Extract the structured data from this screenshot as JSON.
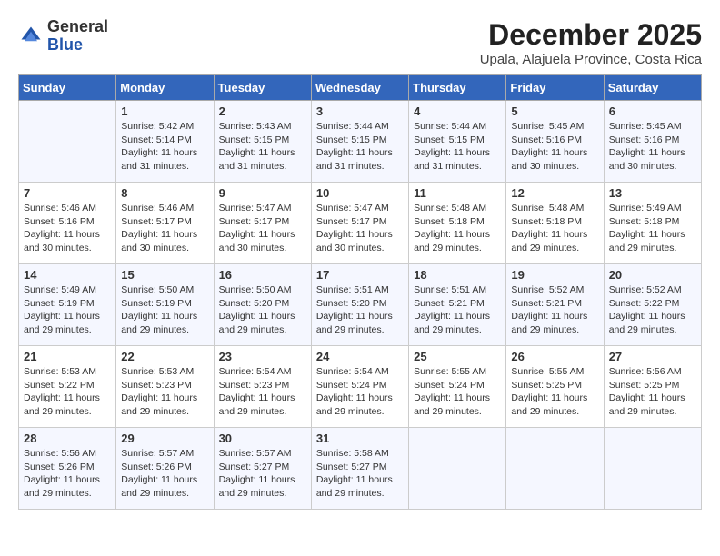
{
  "header": {
    "logo_general": "General",
    "logo_blue": "Blue",
    "month_year": "December 2025",
    "location": "Upala, Alajuela Province, Costa Rica"
  },
  "days_of_week": [
    "Sunday",
    "Monday",
    "Tuesday",
    "Wednesday",
    "Thursday",
    "Friday",
    "Saturday"
  ],
  "weeks": [
    [
      {
        "day": "",
        "info": ""
      },
      {
        "day": "1",
        "info": "Sunrise: 5:42 AM\nSunset: 5:14 PM\nDaylight: 11 hours and 31 minutes."
      },
      {
        "day": "2",
        "info": "Sunrise: 5:43 AM\nSunset: 5:15 PM\nDaylight: 11 hours and 31 minutes."
      },
      {
        "day": "3",
        "info": "Sunrise: 5:44 AM\nSunset: 5:15 PM\nDaylight: 11 hours and 31 minutes."
      },
      {
        "day": "4",
        "info": "Sunrise: 5:44 AM\nSunset: 5:15 PM\nDaylight: 11 hours and 31 minutes."
      },
      {
        "day": "5",
        "info": "Sunrise: 5:45 AM\nSunset: 5:16 PM\nDaylight: 11 hours and 30 minutes."
      },
      {
        "day": "6",
        "info": "Sunrise: 5:45 AM\nSunset: 5:16 PM\nDaylight: 11 hours and 30 minutes."
      }
    ],
    [
      {
        "day": "7",
        "info": "Sunrise: 5:46 AM\nSunset: 5:16 PM\nDaylight: 11 hours and 30 minutes."
      },
      {
        "day": "8",
        "info": "Sunrise: 5:46 AM\nSunset: 5:17 PM\nDaylight: 11 hours and 30 minutes."
      },
      {
        "day": "9",
        "info": "Sunrise: 5:47 AM\nSunset: 5:17 PM\nDaylight: 11 hours and 30 minutes."
      },
      {
        "day": "10",
        "info": "Sunrise: 5:47 AM\nSunset: 5:17 PM\nDaylight: 11 hours and 30 minutes."
      },
      {
        "day": "11",
        "info": "Sunrise: 5:48 AM\nSunset: 5:18 PM\nDaylight: 11 hours and 29 minutes."
      },
      {
        "day": "12",
        "info": "Sunrise: 5:48 AM\nSunset: 5:18 PM\nDaylight: 11 hours and 29 minutes."
      },
      {
        "day": "13",
        "info": "Sunrise: 5:49 AM\nSunset: 5:18 PM\nDaylight: 11 hours and 29 minutes."
      }
    ],
    [
      {
        "day": "14",
        "info": "Sunrise: 5:49 AM\nSunset: 5:19 PM\nDaylight: 11 hours and 29 minutes."
      },
      {
        "day": "15",
        "info": "Sunrise: 5:50 AM\nSunset: 5:19 PM\nDaylight: 11 hours and 29 minutes."
      },
      {
        "day": "16",
        "info": "Sunrise: 5:50 AM\nSunset: 5:20 PM\nDaylight: 11 hours and 29 minutes."
      },
      {
        "day": "17",
        "info": "Sunrise: 5:51 AM\nSunset: 5:20 PM\nDaylight: 11 hours and 29 minutes."
      },
      {
        "day": "18",
        "info": "Sunrise: 5:51 AM\nSunset: 5:21 PM\nDaylight: 11 hours and 29 minutes."
      },
      {
        "day": "19",
        "info": "Sunrise: 5:52 AM\nSunset: 5:21 PM\nDaylight: 11 hours and 29 minutes."
      },
      {
        "day": "20",
        "info": "Sunrise: 5:52 AM\nSunset: 5:22 PM\nDaylight: 11 hours and 29 minutes."
      }
    ],
    [
      {
        "day": "21",
        "info": "Sunrise: 5:53 AM\nSunset: 5:22 PM\nDaylight: 11 hours and 29 minutes."
      },
      {
        "day": "22",
        "info": "Sunrise: 5:53 AM\nSunset: 5:23 PM\nDaylight: 11 hours and 29 minutes."
      },
      {
        "day": "23",
        "info": "Sunrise: 5:54 AM\nSunset: 5:23 PM\nDaylight: 11 hours and 29 minutes."
      },
      {
        "day": "24",
        "info": "Sunrise: 5:54 AM\nSunset: 5:24 PM\nDaylight: 11 hours and 29 minutes."
      },
      {
        "day": "25",
        "info": "Sunrise: 5:55 AM\nSunset: 5:24 PM\nDaylight: 11 hours and 29 minutes."
      },
      {
        "day": "26",
        "info": "Sunrise: 5:55 AM\nSunset: 5:25 PM\nDaylight: 11 hours and 29 minutes."
      },
      {
        "day": "27",
        "info": "Sunrise: 5:56 AM\nSunset: 5:25 PM\nDaylight: 11 hours and 29 minutes."
      }
    ],
    [
      {
        "day": "28",
        "info": "Sunrise: 5:56 AM\nSunset: 5:26 PM\nDaylight: 11 hours and 29 minutes."
      },
      {
        "day": "29",
        "info": "Sunrise: 5:57 AM\nSunset: 5:26 PM\nDaylight: 11 hours and 29 minutes."
      },
      {
        "day": "30",
        "info": "Sunrise: 5:57 AM\nSunset: 5:27 PM\nDaylight: 11 hours and 29 minutes."
      },
      {
        "day": "31",
        "info": "Sunrise: 5:58 AM\nSunset: 5:27 PM\nDaylight: 11 hours and 29 minutes."
      },
      {
        "day": "",
        "info": ""
      },
      {
        "day": "",
        "info": ""
      },
      {
        "day": "",
        "info": ""
      }
    ]
  ]
}
